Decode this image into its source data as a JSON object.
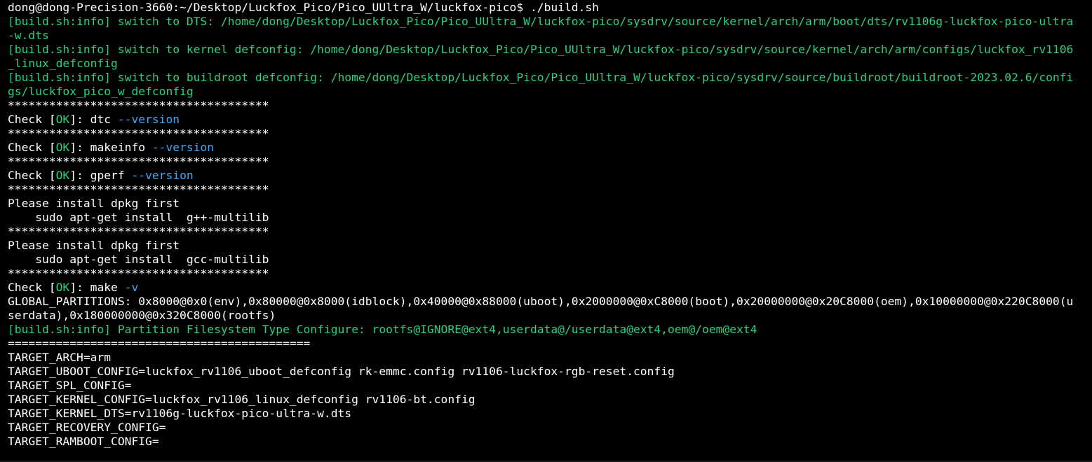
{
  "terminal": {
    "colors": {
      "background": "#000000",
      "text": "#ffffff",
      "info_green": "#2bd17e",
      "option_blue": "#3fa9f5"
    },
    "lines": [
      [
        {
          "t": "dong@dong-Precision-3660:~/Desktop/Luckfox_Pico/Pico_UUltra_W/luckfox-pico$ ./build.sh",
          "c": "w"
        }
      ],
      [
        {
          "t": "[build.sh:info] switch to DTS: /home/dong/Desktop/Luckfox_Pico/Pico_UUltra_W/luckfox-pico/sysdrv/source/kernel/arch/arm/boot/dts/rv1106g-luckfox-pico-ultra",
          "c": "g"
        }
      ],
      [
        {
          "t": "-w.dts",
          "c": "g"
        }
      ],
      [
        {
          "t": "[build.sh:info] switch to kernel defconfig: /home/dong/Desktop/Luckfox_Pico/Pico_UUltra_W/luckfox-pico/sysdrv/source/kernel/arch/arm/configs/luckfox_rv1106",
          "c": "g"
        }
      ],
      [
        {
          "t": "_linux_defconfig",
          "c": "g"
        }
      ],
      [
        {
          "t": "[build.sh:info] switch to buildroot defconfig: /home/dong/Desktop/Luckfox_Pico/Pico_UUltra_W/luckfox-pico/sysdrv/source/buildroot/buildroot-2023.02.6/confi",
          "c": "g"
        }
      ],
      [
        {
          "t": "gs/luckfox_pico_w_defconfig",
          "c": "g"
        }
      ],
      [
        {
          "t": "**************************************",
          "c": "w"
        }
      ],
      [
        {
          "t": "Check [",
          "c": "w"
        },
        {
          "t": "OK",
          "c": "g"
        },
        {
          "t": "]: dtc ",
          "c": "w"
        },
        {
          "t": "--version",
          "c": "c"
        }
      ],
      [
        {
          "t": "**************************************",
          "c": "w"
        }
      ],
      [
        {
          "t": "Check [",
          "c": "w"
        },
        {
          "t": "OK",
          "c": "g"
        },
        {
          "t": "]: makeinfo ",
          "c": "w"
        },
        {
          "t": "--version",
          "c": "c"
        }
      ],
      [
        {
          "t": "**************************************",
          "c": "w"
        }
      ],
      [
        {
          "t": "Check [",
          "c": "w"
        },
        {
          "t": "OK",
          "c": "g"
        },
        {
          "t": "]: gperf ",
          "c": "w"
        },
        {
          "t": "--version",
          "c": "c"
        }
      ],
      [
        {
          "t": "**************************************",
          "c": "w"
        }
      ],
      [
        {
          "t": "Please install dpkg first",
          "c": "w"
        }
      ],
      [
        {
          "t": "    sudo apt-get install  g++-multilib",
          "c": "w"
        }
      ],
      [
        {
          "t": "**************************************",
          "c": "w"
        }
      ],
      [
        {
          "t": "Please install dpkg first",
          "c": "w"
        }
      ],
      [
        {
          "t": "    sudo apt-get install  gcc-multilib",
          "c": "w"
        }
      ],
      [
        {
          "t": "**************************************",
          "c": "w"
        }
      ],
      [
        {
          "t": "Check [",
          "c": "w"
        },
        {
          "t": "OK",
          "c": "g"
        },
        {
          "t": "]: make ",
          "c": "w"
        },
        {
          "t": "-v",
          "c": "c"
        }
      ],
      [
        {
          "t": "GLOBAL_PARTITIONS: 0x8000@0x0(env),0x80000@0x8000(idblock),0x40000@0x88000(uboot),0x2000000@0xC8000(boot),0x20000000@0x20C8000(oem),0x10000000@0x220C8000(u",
          "c": "w"
        }
      ],
      [
        {
          "t": "serdata),0x180000000@0x320C8000(rootfs)",
          "c": "w"
        }
      ],
      [
        {
          "t": "[build.sh:info] Partition Filesystem Type Configure: rootfs@IGNORE@ext4,userdata@/userdata@ext4,oem@/oem@ext4",
          "c": "g"
        }
      ],
      [
        {
          "t": "============================================",
          "c": "w"
        }
      ],
      [
        {
          "t": "TARGET_ARCH=arm",
          "c": "w"
        }
      ],
      [
        {
          "t": "TARGET_UBOOT_CONFIG=luckfox_rv1106_uboot_defconfig rk-emmc.config rv1106-luckfox-rgb-reset.config",
          "c": "w"
        }
      ],
      [
        {
          "t": "TARGET_SPL_CONFIG=",
          "c": "w"
        }
      ],
      [
        {
          "t": "TARGET_KERNEL_CONFIG=luckfox_rv1106_linux_defconfig rv1106-bt.config",
          "c": "w"
        }
      ],
      [
        {
          "t": "TARGET_KERNEL_DTS=rv1106g-luckfox-pico-ultra-w.dts",
          "c": "w"
        }
      ],
      [
        {
          "t": "TARGET_RECOVERY_CONFIG=",
          "c": "w"
        }
      ],
      [
        {
          "t": "TARGET_RAMBOOT_CONFIG=",
          "c": "w"
        }
      ]
    ]
  }
}
